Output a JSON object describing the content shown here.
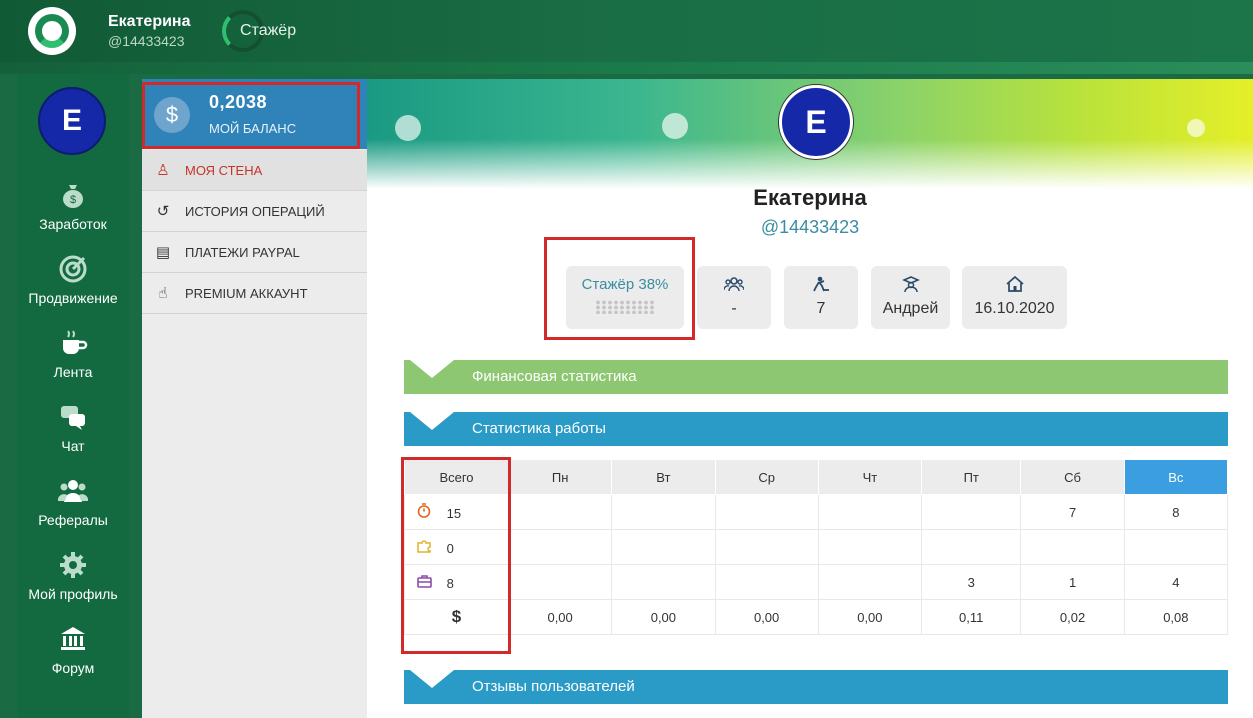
{
  "topbar": {
    "user_name": "Екатерина",
    "user_handle": "@14433423",
    "rank": "Стажёр"
  },
  "leftnav": {
    "avatar_letter": "Е",
    "items": [
      {
        "label": "Заработок",
        "icon": "money-bag-icon"
      },
      {
        "label": "Продвижение",
        "icon": "target-icon"
      },
      {
        "label": "Лента",
        "icon": "coffee-cup-icon"
      },
      {
        "label": "Чат",
        "icon": "chat-bubbles-icon"
      },
      {
        "label": "Рефералы",
        "icon": "people-icon"
      },
      {
        "label": "Мой профиль",
        "icon": "gear-icon"
      },
      {
        "label": "Форум",
        "icon": "bank-icon"
      }
    ]
  },
  "submenu": {
    "balance_amount": "0,2038",
    "balance_label": "МОЙ БАЛАНС",
    "items": [
      {
        "label": "МОЯ СТЕНА",
        "icon": "wall-icon",
        "active": true
      },
      {
        "label": "ИСТОРИЯ ОПЕРАЦИЙ",
        "icon": "history-icon",
        "active": false
      },
      {
        "label": "ПЛАТЕЖИ PAYPAL",
        "icon": "clipboard-icon",
        "active": false
      },
      {
        "label": "PREMIUM АККАУНТ",
        "icon": "hand-pointer-icon",
        "active": false
      }
    ]
  },
  "profile": {
    "avatar_letter": "Е",
    "name": "Екатерина",
    "handle": "@14433423",
    "rank_label": "Стажёр 38%",
    "rank_progress": 0.38,
    "stats": [
      {
        "icon": "referrals-icon",
        "value": "-"
      },
      {
        "icon": "worker-icon",
        "value": "7"
      },
      {
        "icon": "mentor-icon",
        "value": "Андрей"
      },
      {
        "icon": "home-icon",
        "value": "16.10.2020"
      }
    ]
  },
  "sections": {
    "finance": "Финансовая статистика",
    "work": "Статистика работы",
    "reviews": "Отзывы пользователей"
  },
  "work_table": {
    "headers": [
      "Всего",
      "Пн",
      "Вт",
      "Ср",
      "Чт",
      "Пт",
      "Сб",
      "Вс"
    ],
    "rows": [
      {
        "icon": "stopwatch-icon",
        "total": "15",
        "days": [
          "",
          "",
          "",
          "",
          "",
          "7",
          "8"
        ]
      },
      {
        "icon": "puzzle-icon",
        "total": "0",
        "days": [
          "",
          "",
          "",
          "",
          "",
          "",
          ""
        ]
      },
      {
        "icon": "briefcase-icon",
        "total": "8",
        "days": [
          "",
          "",
          "",
          "",
          "3",
          "1",
          "4"
        ]
      },
      {
        "icon": "dollar-icon",
        "total": "$",
        "days": [
          "0,00",
          "0,00",
          "0,00",
          "0,00",
          "0,11",
          "0,02",
          "0,08"
        ]
      }
    ]
  },
  "colors": {
    "accent_red": "#d22a2a",
    "blue": "#2a9ac6",
    "green": "#8dc772",
    "sunday": "#3b9ee0"
  }
}
